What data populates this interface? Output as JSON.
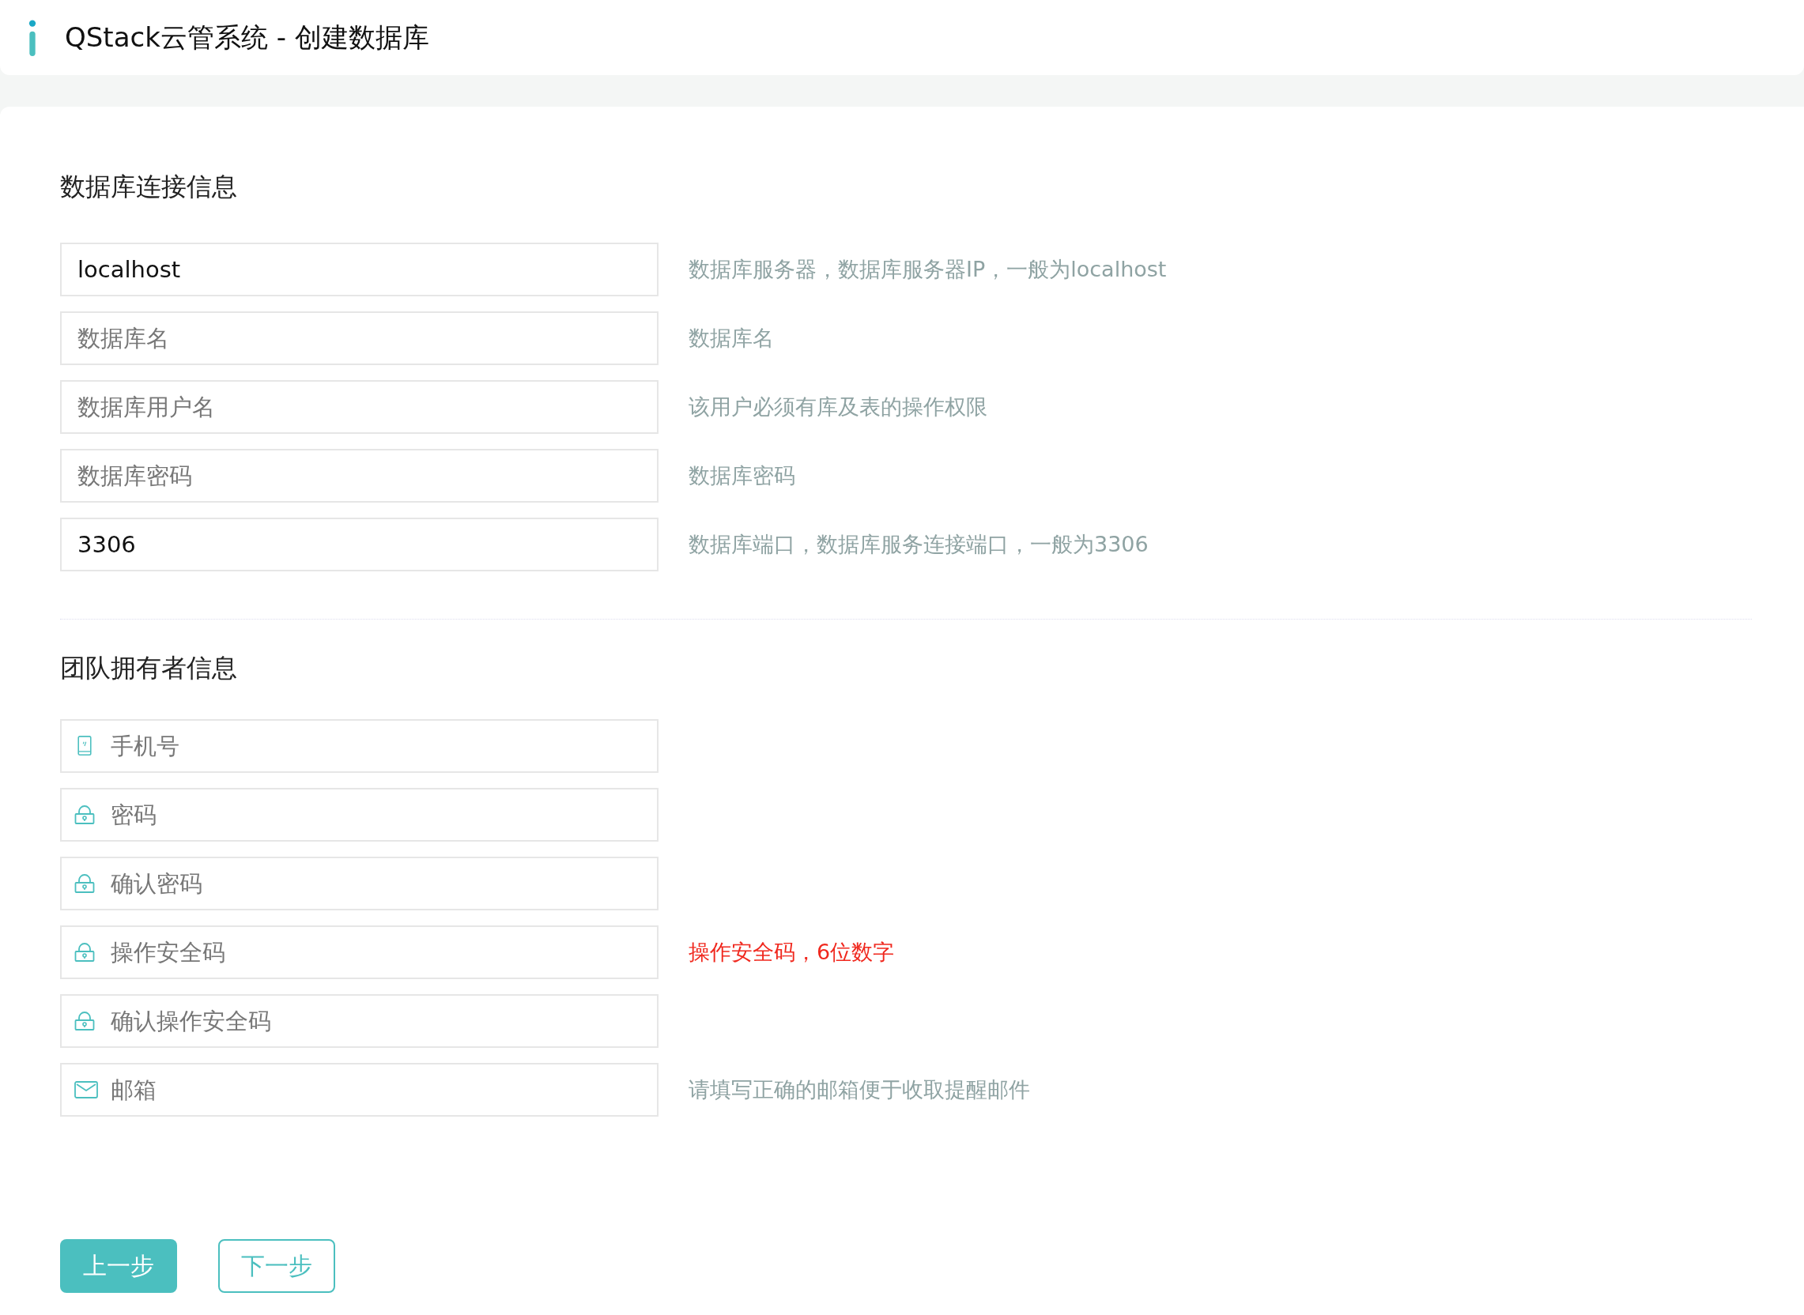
{
  "header": {
    "title": "QStack云管系统 - 创建数据库"
  },
  "sections": [
    {
      "title": "数据库连接信息",
      "fields": [
        {
          "kind": "plain",
          "value": "localhost",
          "hint": {
            "text": "数据库服务器，数据库服务器IP，一般为localhost",
            "kind": "info"
          }
        },
        {
          "kind": "plain",
          "placeholder": "数据库名",
          "hint": {
            "text": "数据库名",
            "kind": "info"
          }
        },
        {
          "kind": "plain",
          "placeholder": "数据库用户名",
          "hint": {
            "text": "该用户必须有库及表的操作权限",
            "kind": "info"
          }
        },
        {
          "kind": "plain",
          "placeholder": "数据库密码",
          "hint": {
            "text": "数据库密码",
            "kind": "info"
          }
        },
        {
          "kind": "plain",
          "value": "3306",
          "hint": {
            "text": "数据库端口，数据库服务连接端口，一般为3306",
            "kind": "info"
          }
        }
      ]
    },
    {
      "title": "团队拥有者信息",
      "fields": [
        {
          "kind": "phone",
          "placeholder": "手机号"
        },
        {
          "kind": "password",
          "placeholder": "密码"
        },
        {
          "kind": "password",
          "placeholder": "确认密码"
        },
        {
          "kind": "password",
          "placeholder": "操作安全码",
          "hint": {
            "text": "操作安全码，6位数字",
            "kind": "warning"
          }
        },
        {
          "kind": "password",
          "placeholder": "确认操作安全码"
        },
        {
          "kind": "email",
          "placeholder": "邮箱",
          "hint": {
            "text": "请填写正确的邮箱便于收取提醒邮件",
            "kind": "info"
          }
        }
      ]
    }
  ],
  "buttons": [
    {
      "label": "上一步",
      "kind": "primary"
    },
    {
      "label": "下一步",
      "kind": "outline"
    }
  ]
}
